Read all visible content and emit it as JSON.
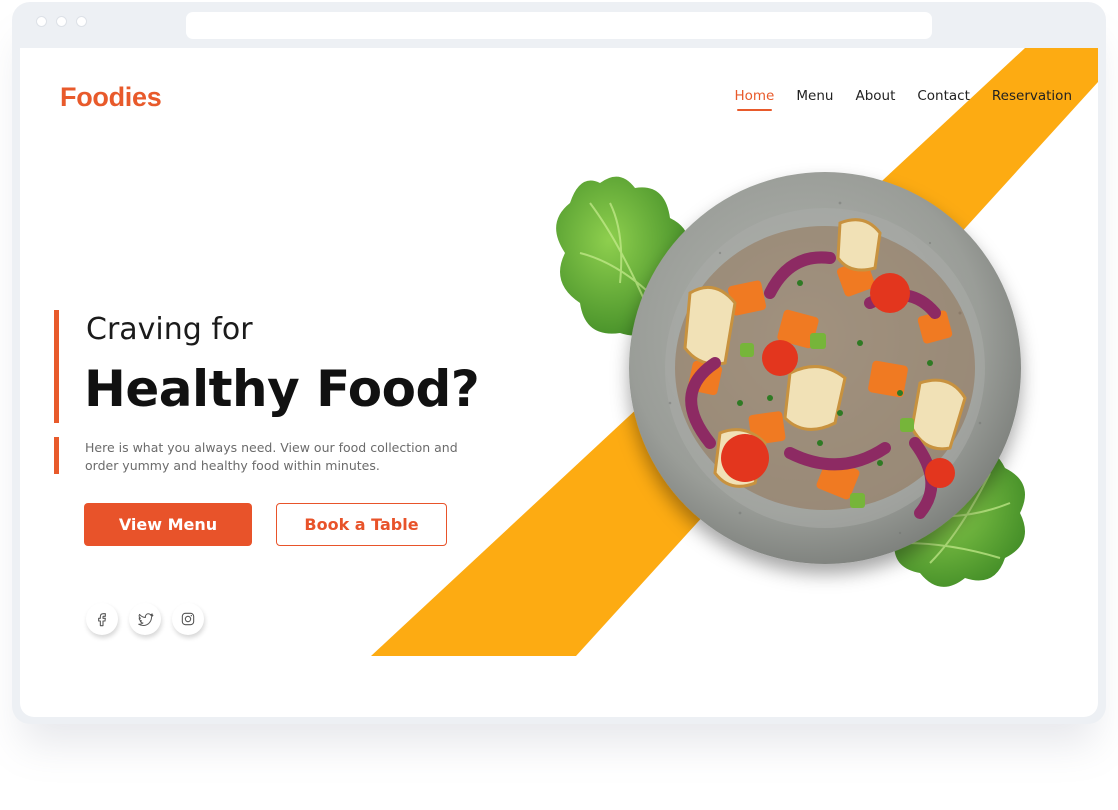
{
  "site": {
    "logo": "Foodies"
  },
  "nav": {
    "items": [
      "Home",
      "Menu",
      "About",
      "Contact",
      "Reservation"
    ],
    "active": "Home"
  },
  "hero": {
    "kicker": "Craving for",
    "headline": "Healthy Food?",
    "description": "Here is what you always need. View our food collection and order yummy and healthy food within minutes."
  },
  "buttons": {
    "primary_label": "View Menu",
    "secondary_label": "Book a Table"
  },
  "socials": [
    "facebook-icon",
    "twitter-icon",
    "instagram-icon"
  ],
  "colors": {
    "brand": "#e85a2b",
    "stripe": "#fdab12",
    "heading": "#111111",
    "body": "#6b6b6b"
  }
}
